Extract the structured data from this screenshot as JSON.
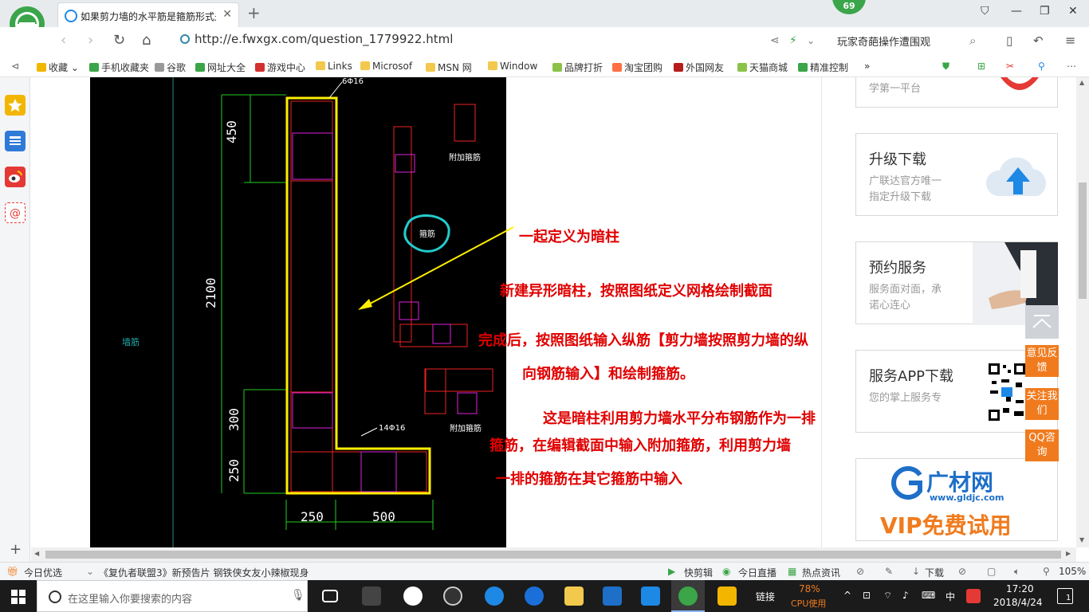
{
  "browser": {
    "tab_title": "如果剪力墙的水平筋是箍筋形式是",
    "tab_close": "✕",
    "new_tab": "+",
    "badge_count": "69",
    "url": "http://e.fwxgx.com/question_1779922.html",
    "search_box_text": "玩家奇葩操作遭围观"
  },
  "bookmarks": [
    {
      "label": "收藏",
      "color": "#f2b600"
    },
    {
      "label": "手机收藏夹",
      "color": "#3aa549"
    },
    {
      "label": "谷歌",
      "color": "#999999"
    },
    {
      "label": "网址大全",
      "color": "#3aa549"
    },
    {
      "label": "游戏中心",
      "color": "#d32f2f"
    },
    {
      "label": "Links",
      "color": "#f2c94c"
    },
    {
      "label": "Microsof",
      "color": "#f2c94c"
    },
    {
      "label": "MSN 网",
      "color": "#f2c94c"
    },
    {
      "label": "Window",
      "color": "#f2c94c"
    },
    {
      "label": "品牌打折",
      "color": "#8bc34a"
    },
    {
      "label": "淘宝团购",
      "color": "#ff7043"
    },
    {
      "label": "外国网友",
      "color": "#b71c1c"
    },
    {
      "label": "天猫商城",
      "color": "#8bc34a"
    },
    {
      "label": "精准控制",
      "color": "#3aa549"
    }
  ],
  "bookmarks_more": "»",
  "drawing": {
    "dims": {
      "d450": "450",
      "d2100": "2100",
      "d300": "300",
      "d250v": "250",
      "d250h": "250",
      "d500": "500",
      "bar_top": "6Φ16",
      "bar_bottom": "14Φ16"
    },
    "labels": {
      "fujia_top": "附加箍筋",
      "gujin": "箍筋",
      "fujia_bottom": "附加箍筋",
      "left_note": "墙筋"
    }
  },
  "annotations": {
    "a1": "一起定义为暗柱",
    "a2": "新建异形暗柱，按照图纸定义网格绘制截面",
    "a3": "完成后，按照图纸输入纵筋【剪力墙按照剪力墙的纵",
    "a4": "向钢筋输入】和绘制箍筋。",
    "a5": "这是暗柱利用剪力墙水平分布钢筋作为一排",
    "a6": "箍筋，在编辑截面中输入附加箍筋，利用剪力墙",
    "a7": "一排的箍筋在其它箍筋中输入"
  },
  "right_panel": {
    "top_card_sub": "学第一平台",
    "upgrade": {
      "title": "升级下载",
      "line1": "广联达官方唯一",
      "line2": "指定升级下载"
    },
    "booking": {
      "title": "预约服务",
      "line1": "服务面对面，承",
      "line2": "诺心连心"
    },
    "app": {
      "title": "服务APP下载",
      "line1": "您的掌上服务专"
    },
    "ad": {
      "brand": "广材网",
      "site": "www.gldjc.com",
      "promo": "VIP免费试用"
    },
    "float": {
      "feedback": "意见反馈",
      "follow": "关注我们",
      "qq": "QQ咨询"
    }
  },
  "statusbar": {
    "today": "今日优选",
    "news": "《复仇者联盟3》新预告片 钢铁侠女友小辣椒现身",
    "quick_cut": "快剪辑",
    "live": "今日直播",
    "hot": "热点资讯",
    "download": "下载",
    "zoom": "105%"
  },
  "taskbar": {
    "search_placeholder": "在这里输入你要搜索的内容",
    "links": "链接",
    "cpu_pct": "78%",
    "cpu_label": "CPU使用",
    "ime": "中",
    "time": "17:20",
    "date": "2018/4/24",
    "notif": "1"
  },
  "colors": {
    "cad_bg": "#000000",
    "annotation_red": "#e00000",
    "float_orange": "#f07b1e",
    "accent_green": "#3aa549"
  }
}
